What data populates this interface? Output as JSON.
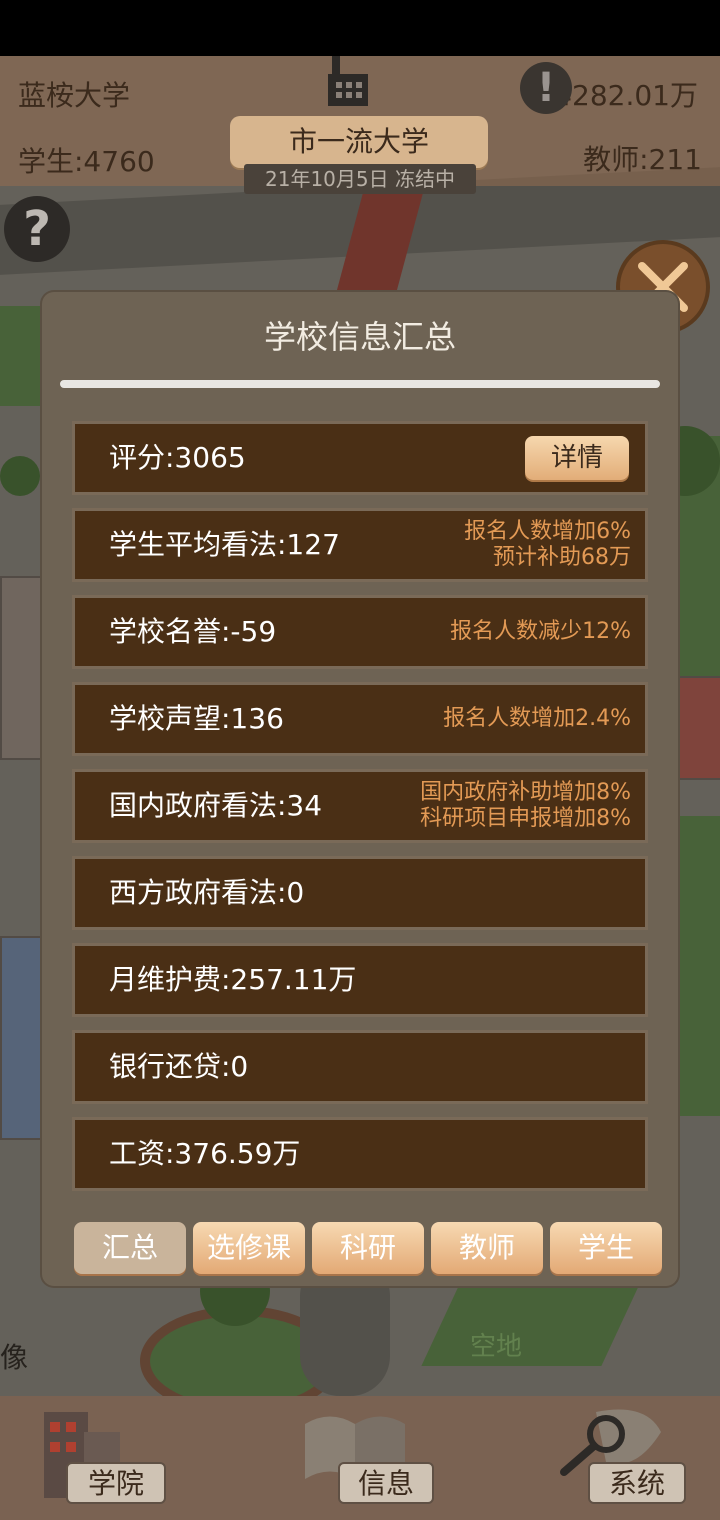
{
  "hud": {
    "university_name": "蓝桉大学",
    "students": "学生:4760",
    "teachers": "教师:211",
    "money": "4282.01万",
    "rank": "市一流大学",
    "date": "21年10月5日 冻结中"
  },
  "scene": {
    "side_label": "像",
    "field_label": "空地"
  },
  "panel": {
    "title": "学校信息汇总",
    "detail_button": "详情",
    "rows": [
      {
        "label": "评分:3065",
        "effects": []
      },
      {
        "label": "学生平均看法:127",
        "effects": [
          "报名人数增加6%",
          "预计补助68万"
        ]
      },
      {
        "label": "学校名誉:-59",
        "effects": [
          "报名人数减少12%"
        ]
      },
      {
        "label": "学校声望:136",
        "effects": [
          "报名人数增加2.4%"
        ]
      },
      {
        "label": "国内政府看法:34",
        "effects": [
          "国内政府补助增加8%",
          "科研项目申报增加8%"
        ]
      },
      {
        "label": "西方政府看法:0",
        "effects": []
      },
      {
        "label": "月维护费:257.11万",
        "effects": []
      },
      {
        "label": "银行还贷:0",
        "effects": []
      },
      {
        "label": "工资:376.59万",
        "effects": []
      }
    ],
    "tabs": [
      "汇总",
      "选修课",
      "科研",
      "教师",
      "学生"
    ]
  },
  "bottom_nav": [
    "学院",
    "信息",
    "系统"
  ],
  "icons": [
    "help-icon",
    "close-icon",
    "alert-icon",
    "factory-icon"
  ],
  "colors": {
    "row_bg": "#4a2f15",
    "effect_text": "#e39a55",
    "panel_bg": "#6e6354"
  }
}
